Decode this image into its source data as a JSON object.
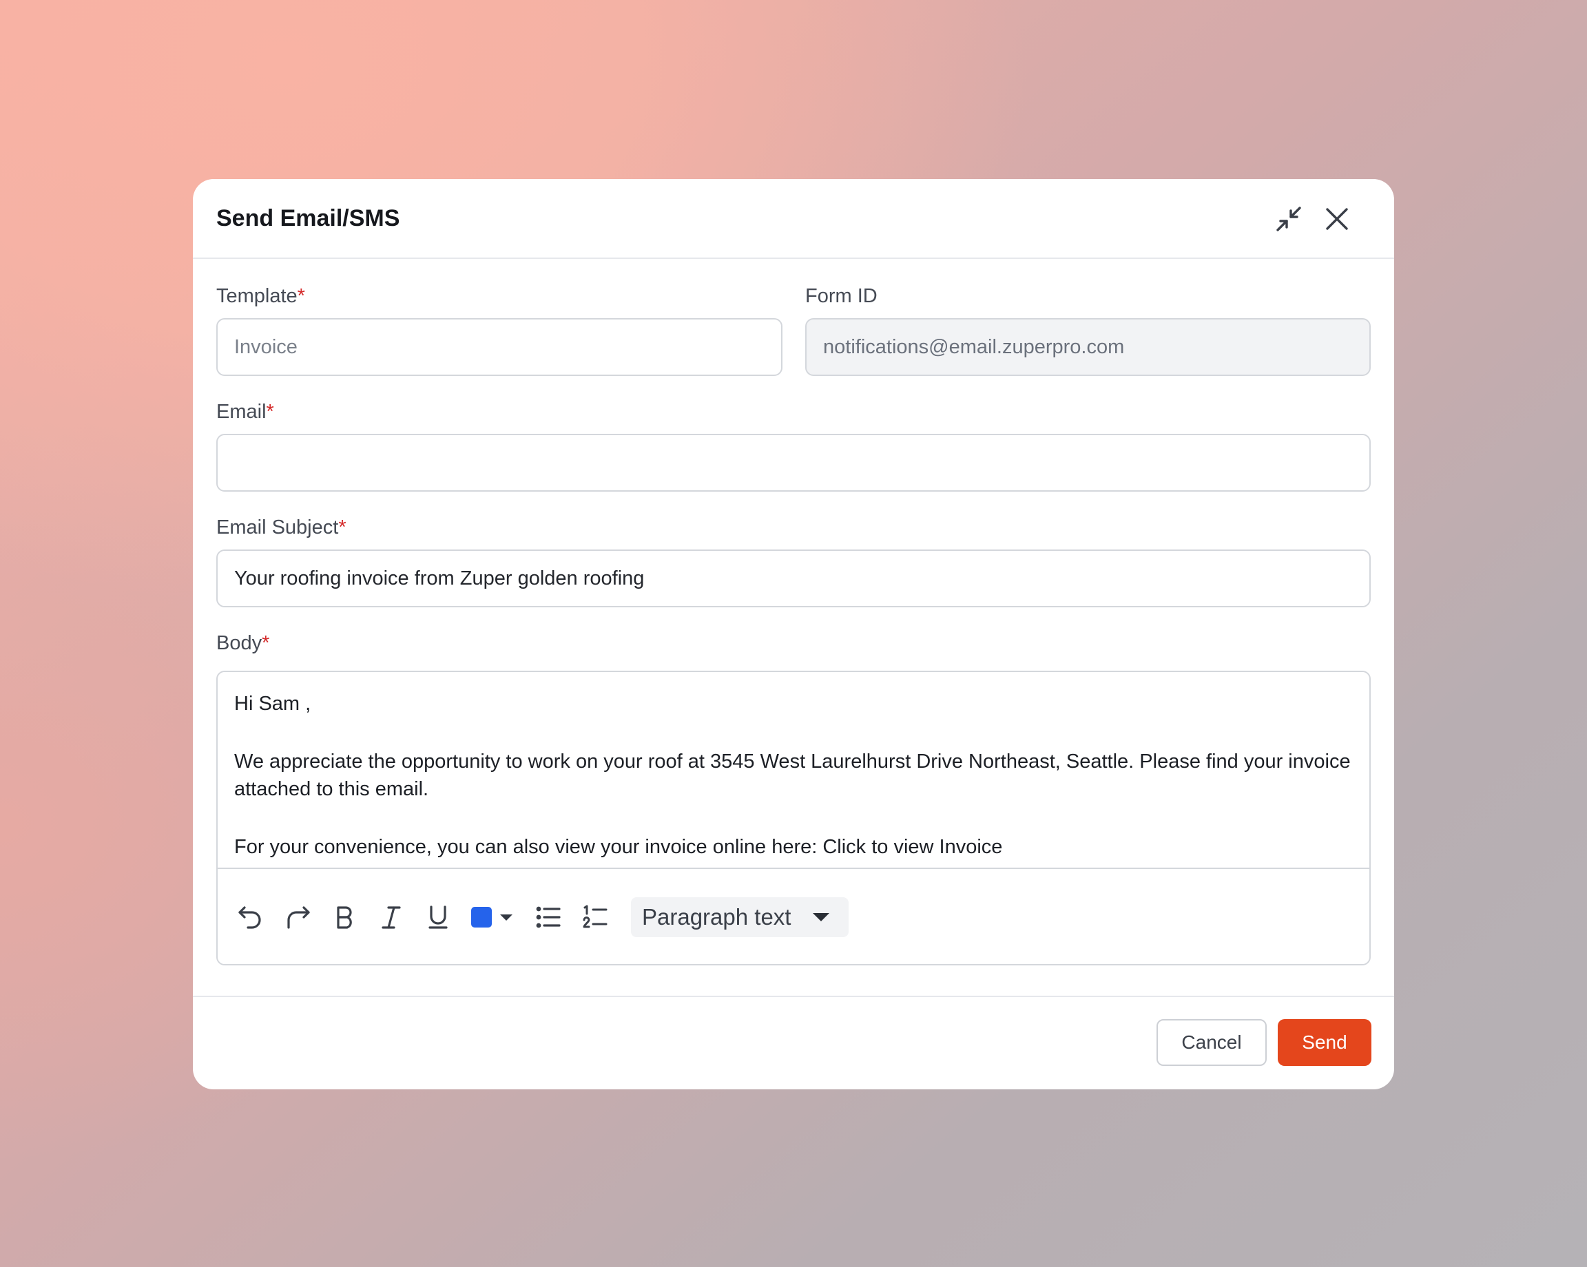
{
  "modal": {
    "title": "Send Email/SMS",
    "icons": {
      "collapse": "collapse-arrows-icon",
      "close": "close-icon"
    }
  },
  "form": {
    "template": {
      "label": "Template",
      "required_mark": "*",
      "value": "Invoice"
    },
    "form_id": {
      "label": "Form ID",
      "value": "notifications@email.zuperpro.com"
    },
    "email": {
      "label": "Email",
      "required_mark": "*",
      "value": ""
    },
    "subject": {
      "label": "Email Subject",
      "required_mark": "*",
      "value": "Your roofing invoice from Zuper golden roofing"
    },
    "body": {
      "label": "Body",
      "required_mark": "*",
      "paragraphs": [
        "Hi Sam ,",
        "We appreciate the opportunity to work on your roof at 3545 West Laurelhurst Drive Northeast, Seattle. Please find your invoice attached to this email.",
        "For your convenience, you can also view your invoice online here: Click to view Invoice"
      ]
    }
  },
  "toolbar": {
    "icons": [
      "undo-icon",
      "redo-icon",
      "bold-icon",
      "italic-icon",
      "underline-icon",
      "text-color-icon",
      "bullet-list-icon",
      "numbered-list-icon"
    ],
    "text_color": "#2563eb",
    "block_style": "Paragraph text"
  },
  "footer": {
    "cancel_label": "Cancel",
    "send_label": "Send"
  },
  "colors": {
    "accent": "#e4461c",
    "required": "#d42a2a",
    "swatch": "#2563eb"
  }
}
